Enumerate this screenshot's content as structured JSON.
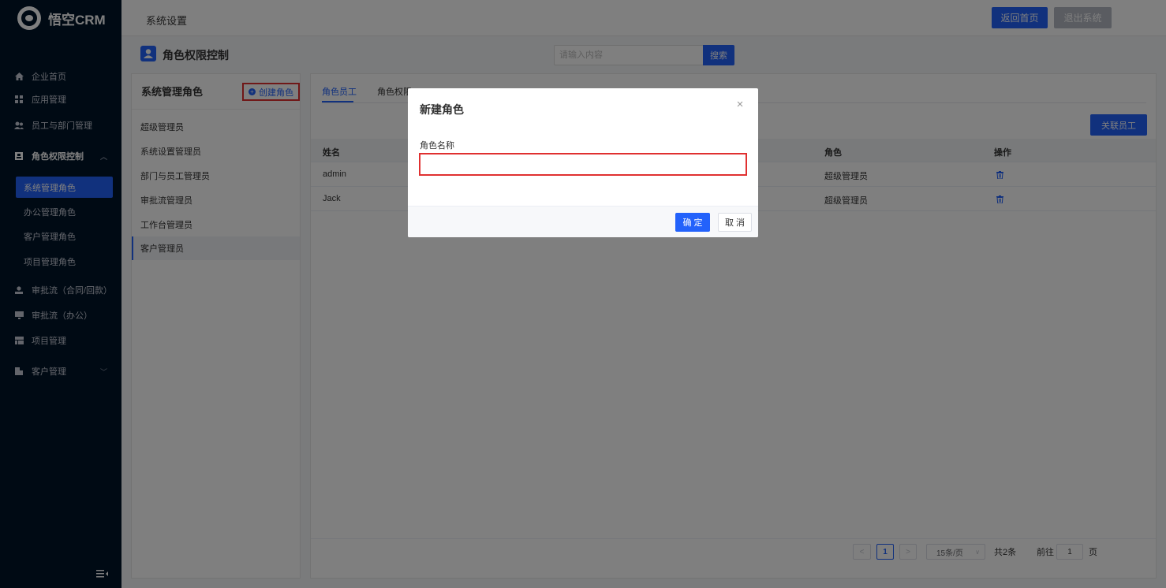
{
  "app": {
    "name": "悟空CRM",
    "section_title": "系统设置"
  },
  "header": {
    "home_button": "返回首页",
    "exit_button": "退出系统"
  },
  "sidebar": {
    "items": [
      {
        "label": "企业首页",
        "icon": "home-icon"
      },
      {
        "label": "应用管理",
        "icon": "apps-icon"
      },
      {
        "label": "员工与部门管理",
        "icon": "users-icon"
      },
      {
        "label": "角色权限控制",
        "icon": "role-icon",
        "expanded": true
      },
      {
        "label": "审批流（合同/回款）",
        "icon": "approval-icon"
      },
      {
        "label": "审批流（办公）",
        "icon": "monitor-icon"
      },
      {
        "label": "项目管理",
        "icon": "project-icon"
      },
      {
        "label": "客户管理",
        "icon": "customer-icon"
      }
    ],
    "sub_items": [
      {
        "label": "系统管理角色",
        "active": true
      },
      {
        "label": "办公管理角色"
      },
      {
        "label": "客户管理角色"
      },
      {
        "label": "项目管理角色"
      }
    ]
  },
  "page": {
    "title": "角色权限控制",
    "search_placeholder": "请输入内容",
    "search_button": "搜索"
  },
  "role_panel": {
    "title": "系统管理角色",
    "create_button": "创建角色",
    "roles": [
      "超级管理员",
      "系统设置管理员",
      "部门与员工管理员",
      "审批流管理员",
      "工作台管理员",
      "客户管理员"
    ],
    "selected_index": 5
  },
  "main": {
    "tabs": [
      "角色员工",
      "角色权限"
    ],
    "link_button": "关联员工",
    "columns": {
      "name": "姓名",
      "role": "角色",
      "action": "操作"
    },
    "rows": [
      {
        "name": "admin",
        "role": "超级管理员"
      },
      {
        "name": "Jack",
        "role": "超级管理员"
      }
    ],
    "pagination": {
      "current": "1",
      "page_size": "15条/页",
      "total": "共2条",
      "goto_label": "前往",
      "goto_value": "1",
      "page_unit": "页"
    }
  },
  "modal": {
    "title": "新建角色",
    "field_label": "角色名称",
    "field_value": "",
    "ok_button": "确 定",
    "cancel_button": "取 消"
  },
  "colors": {
    "primary": "#2362fb",
    "sidebar_bg": "#001529",
    "highlight_red": "#e03030"
  }
}
